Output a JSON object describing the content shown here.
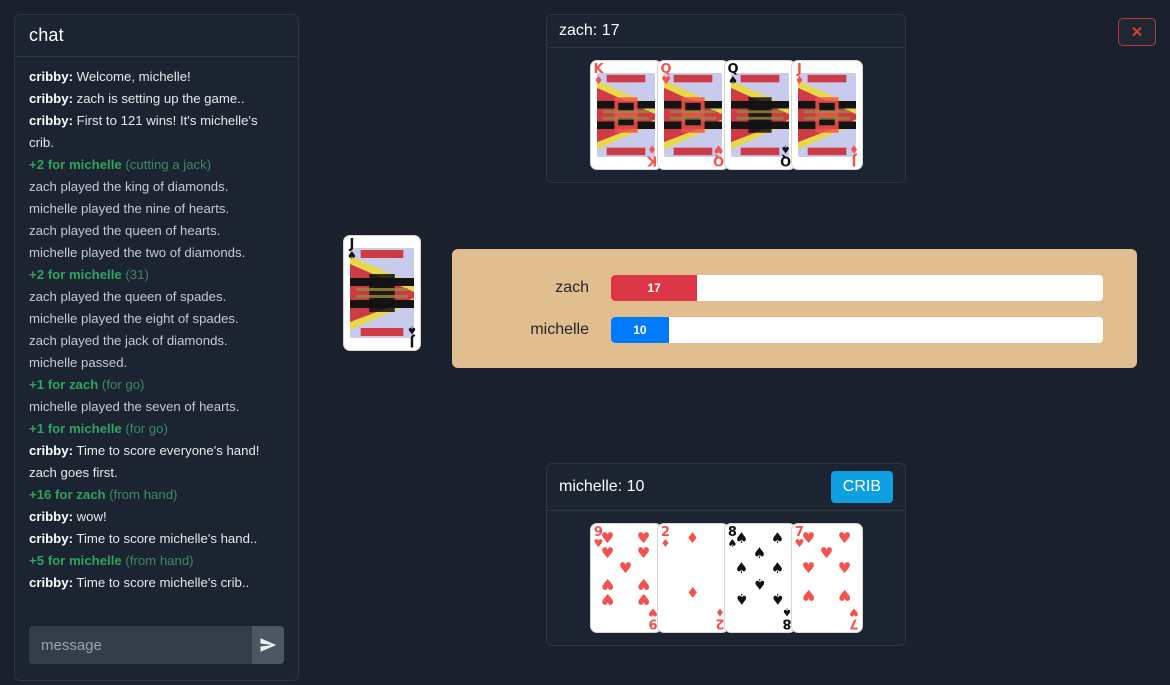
{
  "chat": {
    "title": "chat",
    "messages": [
      {
        "type": "say",
        "who": "cribby:",
        "text": "Welcome, michelle!"
      },
      {
        "type": "say",
        "who": "cribby:",
        "text": "zach is setting up the game.."
      },
      {
        "type": "say",
        "who": "cribby:",
        "text": "First to 121 wins! It's michelle's crib."
      },
      {
        "type": "score",
        "points": "+2 for michelle",
        "note": "(cutting a jack)"
      },
      {
        "type": "plain",
        "text": "zach played the king of diamonds."
      },
      {
        "type": "plain",
        "text": "michelle played the nine of hearts."
      },
      {
        "type": "plain",
        "text": "zach played the queen of hearts."
      },
      {
        "type": "plain",
        "text": "michelle played the two of diamonds."
      },
      {
        "type": "score",
        "points": "+2 for michelle",
        "note": "(31)"
      },
      {
        "type": "plain",
        "text": "zach played the queen of spades."
      },
      {
        "type": "plain",
        "text": "michelle played the eight of spades."
      },
      {
        "type": "plain",
        "text": "zach played the jack of diamonds."
      },
      {
        "type": "plain",
        "text": "michelle passed."
      },
      {
        "type": "score",
        "points": "+1 for zach",
        "note": "(for go)"
      },
      {
        "type": "plain",
        "text": "michelle played the seven of hearts."
      },
      {
        "type": "score",
        "points": "+1 for michelle",
        "note": "(for go)"
      },
      {
        "type": "say",
        "who": "cribby:",
        "text": "Time to score everyone's hand! zach goes first."
      },
      {
        "type": "score",
        "points": "+16 for zach",
        "note": "(from hand)"
      },
      {
        "type": "say",
        "who": "cribby:",
        "text": "wow!"
      },
      {
        "type": "say",
        "who": "cribby:",
        "text": "Time to score michelle's hand.."
      },
      {
        "type": "score",
        "points": "+5 for michelle",
        "note": "(from hand)"
      },
      {
        "type": "say",
        "who": "cribby:",
        "text": "Time to score michelle's crib.."
      }
    ],
    "compose": {
      "placeholder": "message",
      "send_label": "send-icon"
    }
  },
  "close_button": {
    "label": "✕",
    "icon": "close-icon",
    "color": "#e03b33"
  },
  "hands": [
    {
      "id": "zach",
      "header": "zach: 17",
      "crib": null,
      "cards": [
        {
          "rank": "K",
          "suit": "♦",
          "color": "red",
          "face": true,
          "name": "king-of-diamonds"
        },
        {
          "rank": "Q",
          "suit": "♥",
          "color": "red",
          "face": true,
          "name": "queen-of-hearts"
        },
        {
          "rank": "Q",
          "suit": "♠",
          "color": "black",
          "face": true,
          "name": "queen-of-spades"
        },
        {
          "rank": "J",
          "suit": "♦",
          "color": "red",
          "face": true,
          "name": "jack-of-diamonds"
        }
      ]
    },
    {
      "id": "michelle",
      "header": "michelle: 10",
      "crib": "CRIB",
      "cards": [
        {
          "rank": "9",
          "suit": "♥",
          "color": "red",
          "face": false,
          "name": "nine-of-hearts"
        },
        {
          "rank": "2",
          "suit": "♦",
          "color": "red",
          "face": false,
          "name": "two-of-diamonds"
        },
        {
          "rank": "8",
          "suit": "♠",
          "color": "black",
          "face": false,
          "name": "eight-of-spades"
        },
        {
          "rank": "7",
          "suit": "♥",
          "color": "red",
          "face": false,
          "name": "seven-of-hearts"
        }
      ]
    }
  ],
  "cut_card": {
    "rank": "J",
    "suit": "♠",
    "color": "black",
    "face": true,
    "name": "jack-of-spades"
  },
  "scoreboard": {
    "target": 121,
    "rows": [
      {
        "name": "zach",
        "score": 17,
        "score_label": "17",
        "color": "#dc3545"
      },
      {
        "name": "michelle",
        "score": 10,
        "score_label": "10",
        "color": "#007bff"
      }
    ],
    "background": "#e0be90"
  }
}
